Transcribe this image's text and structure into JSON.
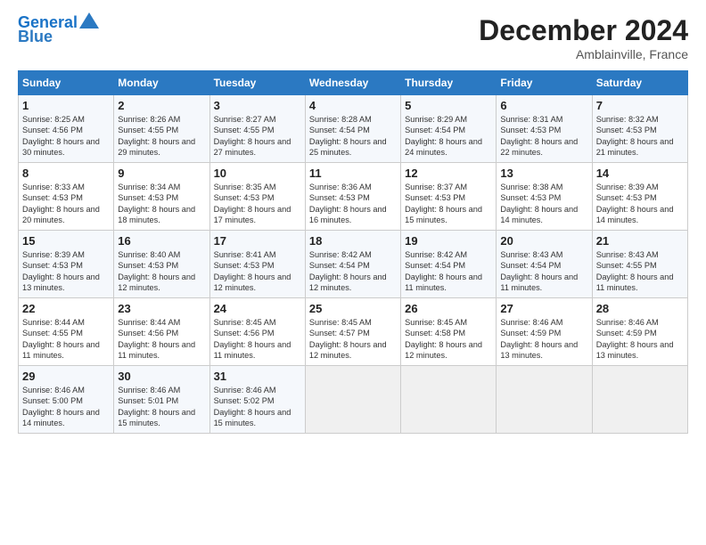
{
  "header": {
    "logo_line1": "General",
    "logo_line2": "Blue",
    "title": "December 2024",
    "location": "Amblainville, France"
  },
  "days_of_week": [
    "Sunday",
    "Monday",
    "Tuesday",
    "Wednesday",
    "Thursday",
    "Friday",
    "Saturday"
  ],
  "weeks": [
    [
      {
        "day": "1",
        "sunrise": "Sunrise: 8:25 AM",
        "sunset": "Sunset: 4:56 PM",
        "daylight": "Daylight: 8 hours and 30 minutes."
      },
      {
        "day": "2",
        "sunrise": "Sunrise: 8:26 AM",
        "sunset": "Sunset: 4:55 PM",
        "daylight": "Daylight: 8 hours and 29 minutes."
      },
      {
        "day": "3",
        "sunrise": "Sunrise: 8:27 AM",
        "sunset": "Sunset: 4:55 PM",
        "daylight": "Daylight: 8 hours and 27 minutes."
      },
      {
        "day": "4",
        "sunrise": "Sunrise: 8:28 AM",
        "sunset": "Sunset: 4:54 PM",
        "daylight": "Daylight: 8 hours and 25 minutes."
      },
      {
        "day": "5",
        "sunrise": "Sunrise: 8:29 AM",
        "sunset": "Sunset: 4:54 PM",
        "daylight": "Daylight: 8 hours and 24 minutes."
      },
      {
        "day": "6",
        "sunrise": "Sunrise: 8:31 AM",
        "sunset": "Sunset: 4:53 PM",
        "daylight": "Daylight: 8 hours and 22 minutes."
      },
      {
        "day": "7",
        "sunrise": "Sunrise: 8:32 AM",
        "sunset": "Sunset: 4:53 PM",
        "daylight": "Daylight: 8 hours and 21 minutes."
      }
    ],
    [
      {
        "day": "8",
        "sunrise": "Sunrise: 8:33 AM",
        "sunset": "Sunset: 4:53 PM",
        "daylight": "Daylight: 8 hours and 20 minutes."
      },
      {
        "day": "9",
        "sunrise": "Sunrise: 8:34 AM",
        "sunset": "Sunset: 4:53 PM",
        "daylight": "Daylight: 8 hours and 18 minutes."
      },
      {
        "day": "10",
        "sunrise": "Sunrise: 8:35 AM",
        "sunset": "Sunset: 4:53 PM",
        "daylight": "Daylight: 8 hours and 17 minutes."
      },
      {
        "day": "11",
        "sunrise": "Sunrise: 8:36 AM",
        "sunset": "Sunset: 4:53 PM",
        "daylight": "Daylight: 8 hours and 16 minutes."
      },
      {
        "day": "12",
        "sunrise": "Sunrise: 8:37 AM",
        "sunset": "Sunset: 4:53 PM",
        "daylight": "Daylight: 8 hours and 15 minutes."
      },
      {
        "day": "13",
        "sunrise": "Sunrise: 8:38 AM",
        "sunset": "Sunset: 4:53 PM",
        "daylight": "Daylight: 8 hours and 14 minutes."
      },
      {
        "day": "14",
        "sunrise": "Sunrise: 8:39 AM",
        "sunset": "Sunset: 4:53 PM",
        "daylight": "Daylight: 8 hours and 14 minutes."
      }
    ],
    [
      {
        "day": "15",
        "sunrise": "Sunrise: 8:39 AM",
        "sunset": "Sunset: 4:53 PM",
        "daylight": "Daylight: 8 hours and 13 minutes."
      },
      {
        "day": "16",
        "sunrise": "Sunrise: 8:40 AM",
        "sunset": "Sunset: 4:53 PM",
        "daylight": "Daylight: 8 hours and 12 minutes."
      },
      {
        "day": "17",
        "sunrise": "Sunrise: 8:41 AM",
        "sunset": "Sunset: 4:53 PM",
        "daylight": "Daylight: 8 hours and 12 minutes."
      },
      {
        "day": "18",
        "sunrise": "Sunrise: 8:42 AM",
        "sunset": "Sunset: 4:54 PM",
        "daylight": "Daylight: 8 hours and 12 minutes."
      },
      {
        "day": "19",
        "sunrise": "Sunrise: 8:42 AM",
        "sunset": "Sunset: 4:54 PM",
        "daylight": "Daylight: 8 hours and 11 minutes."
      },
      {
        "day": "20",
        "sunrise": "Sunrise: 8:43 AM",
        "sunset": "Sunset: 4:54 PM",
        "daylight": "Daylight: 8 hours and 11 minutes."
      },
      {
        "day": "21",
        "sunrise": "Sunrise: 8:43 AM",
        "sunset": "Sunset: 4:55 PM",
        "daylight": "Daylight: 8 hours and 11 minutes."
      }
    ],
    [
      {
        "day": "22",
        "sunrise": "Sunrise: 8:44 AM",
        "sunset": "Sunset: 4:55 PM",
        "daylight": "Daylight: 8 hours and 11 minutes."
      },
      {
        "day": "23",
        "sunrise": "Sunrise: 8:44 AM",
        "sunset": "Sunset: 4:56 PM",
        "daylight": "Daylight: 8 hours and 11 minutes."
      },
      {
        "day": "24",
        "sunrise": "Sunrise: 8:45 AM",
        "sunset": "Sunset: 4:56 PM",
        "daylight": "Daylight: 8 hours and 11 minutes."
      },
      {
        "day": "25",
        "sunrise": "Sunrise: 8:45 AM",
        "sunset": "Sunset: 4:57 PM",
        "daylight": "Daylight: 8 hours and 12 minutes."
      },
      {
        "day": "26",
        "sunrise": "Sunrise: 8:45 AM",
        "sunset": "Sunset: 4:58 PM",
        "daylight": "Daylight: 8 hours and 12 minutes."
      },
      {
        "day": "27",
        "sunrise": "Sunrise: 8:46 AM",
        "sunset": "Sunset: 4:59 PM",
        "daylight": "Daylight: 8 hours and 13 minutes."
      },
      {
        "day": "28",
        "sunrise": "Sunrise: 8:46 AM",
        "sunset": "Sunset: 4:59 PM",
        "daylight": "Daylight: 8 hours and 13 minutes."
      }
    ],
    [
      {
        "day": "29",
        "sunrise": "Sunrise: 8:46 AM",
        "sunset": "Sunset: 5:00 PM",
        "daylight": "Daylight: 8 hours and 14 minutes."
      },
      {
        "day": "30",
        "sunrise": "Sunrise: 8:46 AM",
        "sunset": "Sunset: 5:01 PM",
        "daylight": "Daylight: 8 hours and 15 minutes."
      },
      {
        "day": "31",
        "sunrise": "Sunrise: 8:46 AM",
        "sunset": "Sunset: 5:02 PM",
        "daylight": "Daylight: 8 hours and 15 minutes."
      },
      null,
      null,
      null,
      null
    ]
  ]
}
